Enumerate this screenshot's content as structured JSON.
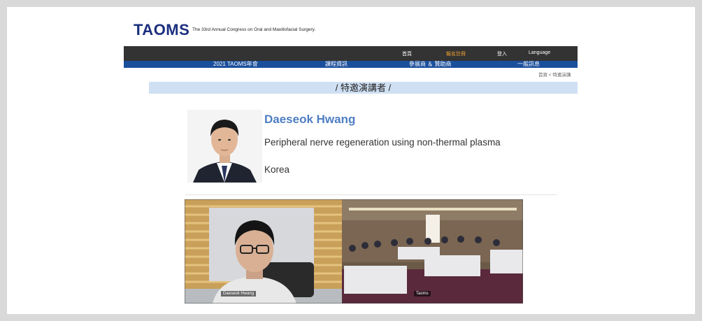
{
  "site": {
    "logo": "TAOMS",
    "tagline": "The 33rd Annual Congress on Oral and Maxillofacial Surgery."
  },
  "top_nav": {
    "items": [
      "首頁",
      "報名註冊",
      "登入",
      "Language"
    ],
    "active_color": "#f0a030"
  },
  "main_nav": {
    "items": [
      "2021 TAOMS年會",
      "課程資訊",
      "參展商 ＆ 贊助商",
      "一般訊息"
    ]
  },
  "breadcrumb": "首頁 < 特邀演講",
  "page_title": "/   特邀演講者   /",
  "speaker": {
    "name": "Daeseok Hwang",
    "topic": "Peripheral nerve regeneration using non-thermal plasma",
    "country": "Korea"
  },
  "video": {
    "participant_left": "Daeseok Hwang",
    "participant_right": "Taoms"
  },
  "colors": {
    "logo": "#1b2f7e",
    "top_nav_bg": "#333333",
    "main_nav_bg": "#1a4f9c",
    "title_bar_bg": "#cfe0f3",
    "speaker_name": "#4f7ec3"
  }
}
